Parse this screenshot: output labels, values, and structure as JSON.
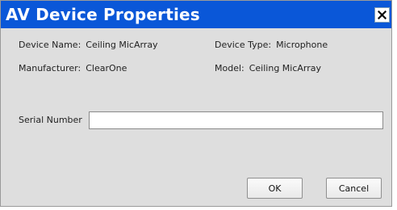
{
  "dialog": {
    "title": "AV Device Properties",
    "close_icon": "close-icon"
  },
  "device": {
    "name_label": "Device Name:",
    "name_value": "Ceiling MicArray",
    "type_label": "Device Type:",
    "type_value": "Microphone",
    "manufacturer_label": "Manufacturer:",
    "manufacturer_value": "ClearOne",
    "model_label": "Model:",
    "model_value": "Ceiling MicArray"
  },
  "serial": {
    "label": "Serial Number",
    "value": ""
  },
  "buttons": {
    "ok": "OK",
    "cancel": "Cancel"
  },
  "colors": {
    "titlebar": "#0a57d8",
    "dialog_bg": "#dedede"
  }
}
